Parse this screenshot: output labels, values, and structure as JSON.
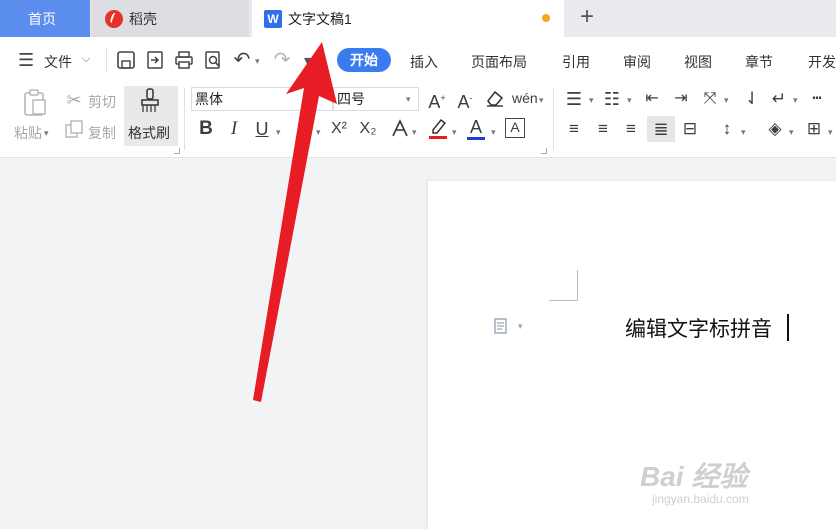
{
  "tabs": {
    "home": "首页",
    "daoke": "稻壳",
    "document": "文字文稿1",
    "doc_icon_letter": "W"
  },
  "menu": {
    "file_label": "文件",
    "tabs": [
      "开始",
      "插入",
      "页面布局",
      "引用",
      "审阅",
      "视图",
      "章节",
      "开发"
    ]
  },
  "ribbon": {
    "paste": "粘贴",
    "cut": "剪切",
    "copy": "复制",
    "format_painter": "格式刷",
    "font_name": "黑体",
    "font_size": "四号",
    "bold": "B",
    "italic": "I",
    "underline": "U",
    "superscript": "X²",
    "subscript": "X₂",
    "font_color": "A",
    "char_border": "A",
    "pinyin": "wén"
  },
  "document": {
    "text": "编辑文字标拼音"
  },
  "watermark": {
    "text": "Bai 经验",
    "url": "jingyan.baidu.com"
  },
  "colors": {
    "accent": "#3a7cf0",
    "home_tab": "#5b8def",
    "highlight_red": "#e0201f",
    "font_color_blue": "#1f3fd6",
    "arrow": "#e81c24",
    "unsaved_dot": "#f5a623"
  }
}
